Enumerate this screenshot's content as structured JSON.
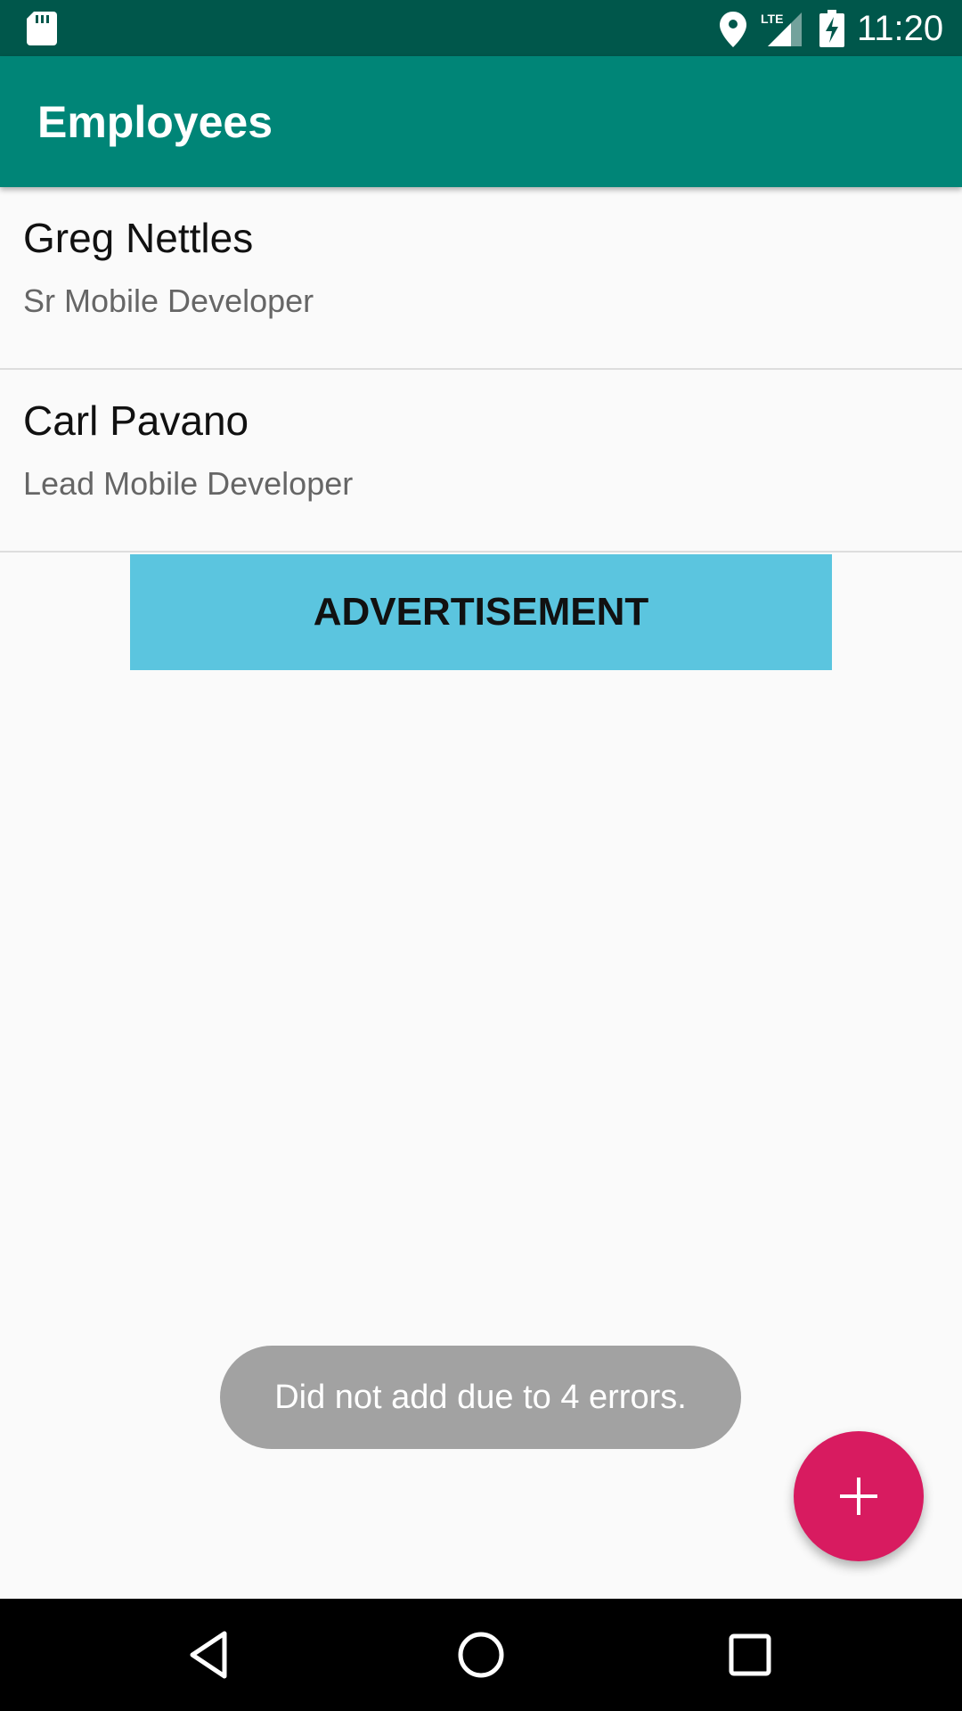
{
  "status_bar": {
    "time": "11:20",
    "network_label": "LTE",
    "icons": [
      "sd-card-icon",
      "location-icon",
      "lte-signal-icon",
      "battery-charging-icon"
    ]
  },
  "app_bar": {
    "title": "Employees"
  },
  "employees": [
    {
      "name": "Greg Nettles",
      "role": "Sr Mobile Developer"
    },
    {
      "name": "Carl Pavano",
      "role": "Lead Mobile Developer"
    }
  ],
  "ad": {
    "text": "ADVERTISEMENT",
    "color": "#5bc5df"
  },
  "toast": {
    "message": "Did not add due to 4 errors."
  },
  "fab": {
    "icon": "plus-icon",
    "color": "#d81b60"
  },
  "nav_bar": {
    "buttons": [
      "back-icon",
      "home-icon",
      "recents-icon"
    ]
  },
  "colors": {
    "primary": "#008577",
    "primary_dark": "#00574b",
    "accent": "#d81b60"
  }
}
